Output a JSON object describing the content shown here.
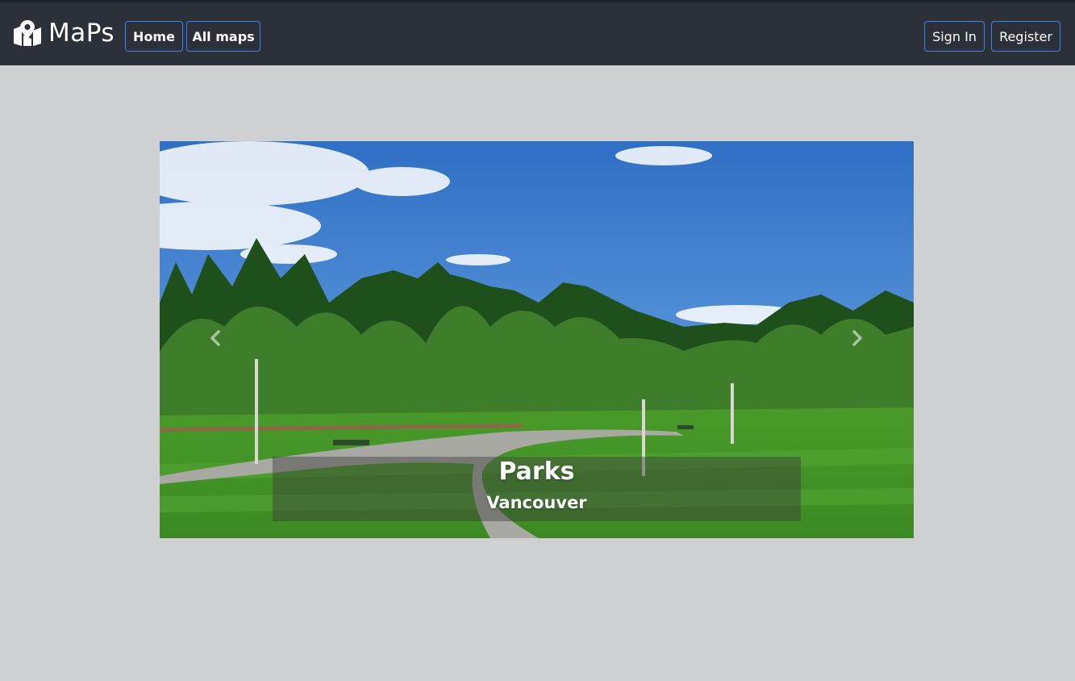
{
  "header": {
    "brand": "MaPs",
    "brand_icon": "map-marker-icon",
    "nav": {
      "home": "Home",
      "all_maps": "All maps"
    },
    "auth": {
      "sign_in": "Sign In",
      "register": "Register"
    }
  },
  "carousel": {
    "active_slide": {
      "title": "Parks",
      "subtitle": "Vancouver",
      "image": "park-landscape-photo"
    },
    "prev_icon": "chevron-left-icon",
    "next_icon": "chevron-right-icon"
  },
  "colors": {
    "topbar": "#2c3038",
    "page_background": "#cfd0d2",
    "button_border": "#3b82f6"
  }
}
